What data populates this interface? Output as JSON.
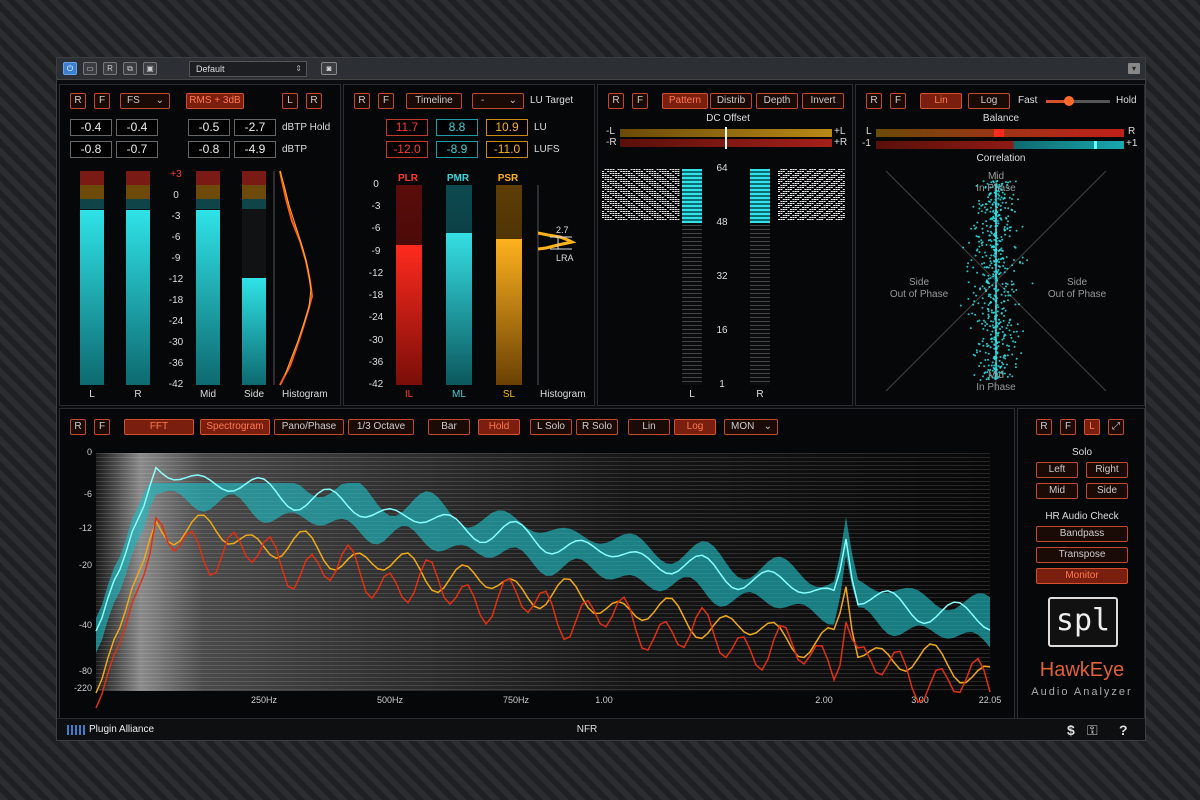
{
  "host": {
    "preset": "Default",
    "buttons": [
      "power-icon",
      "compare-icon",
      "rw-icon",
      "copy-icon",
      "paste-icon"
    ]
  },
  "panel1": {
    "buttons": {
      "r": "R",
      "f": "F",
      "fs": "FS",
      "rms": "RMS + 3dB",
      "l": "L",
      "r2": "R"
    },
    "dbtp_hold_label": "dBTP Hold",
    "dbtp_label": "dBTP",
    "values": {
      "l_hold": "-0.4",
      "r_hold": "-0.4",
      "mid_hold": "-0.5",
      "side_hold": "-2.7",
      "l_dbtp": "-0.8",
      "r_dbtp": "-0.7",
      "mid_dbtp": "-0.8",
      "side_dbtp": "-4.9"
    },
    "scale": [
      "+3",
      "0",
      "-3",
      "-6",
      "-9",
      "-12",
      "-18",
      "-24",
      "-30",
      "-36",
      "-42"
    ],
    "meter_labels": {
      "l": "L",
      "r": "R",
      "mid": "Mid",
      "side": "Side",
      "histogram": "Histogram"
    },
    "levels": {
      "l": 0.82,
      "r": 0.82,
      "mid": 0.82,
      "side": 0.5
    }
  },
  "panel2": {
    "buttons": {
      "r": "R",
      "f": "F",
      "timeline": "Timeline",
      "dash": "-"
    },
    "lu_target": "LU Target",
    "row_lu": [
      "11.7",
      "8.8",
      "10.9"
    ],
    "row_lufs": [
      "-12.0",
      "-8.9",
      "-11.0"
    ],
    "lu_label": "LU",
    "lufs_label": "LUFS",
    "top_labels": [
      "PLR",
      "PMR",
      "PSR"
    ],
    "bottom_labels": [
      "IL",
      "ML",
      "SL",
      "Histogram"
    ],
    "scale": [
      "0",
      "-3",
      "-6",
      "-9",
      "-12",
      "-18",
      "-24",
      "-30",
      "-36",
      "-42"
    ],
    "bar_levels": [
      0.7,
      0.76,
      0.73
    ],
    "lra_value": "2.7",
    "lra_label": "LRA"
  },
  "panel3": {
    "buttons": {
      "r": "R",
      "f": "F",
      "pattern": "Pattern",
      "distrib": "Distrib",
      "depth": "Depth",
      "invert": "Invert"
    },
    "dc_offset": "DC Offset",
    "dc_left": [
      "-L",
      "-R"
    ],
    "dc_right": [
      "+L",
      "+R"
    ],
    "scale": [
      "64",
      "48",
      "32",
      "16",
      "1"
    ],
    "bottom": [
      "L",
      "R"
    ]
  },
  "panel4": {
    "buttons": {
      "r": "R",
      "f": "F",
      "lin": "Lin",
      "log": "Log"
    },
    "fast": "Fast",
    "hold": "Hold",
    "balance": "Balance",
    "bal_l": "L",
    "bal_r": "R",
    "corr_minus": "-1",
    "corr_plus": "+1",
    "correlation": "Correlation",
    "mid_top": [
      "Mid",
      "In Phase"
    ],
    "mid_bottom": [
      "Mid",
      "In Phase"
    ],
    "side_left": [
      "Side",
      "Out of Phase"
    ],
    "side_right": [
      "Side",
      "Out of Phase"
    ]
  },
  "spectrum": {
    "buttons": {
      "r": "R",
      "f": "F",
      "fft": "FFT",
      "spectrogram": "Spectrogram",
      "panophase": "Pano/Phase",
      "octave": "1/3 Octave",
      "bar": "Bar",
      "hold": "Hold",
      "lsolo": "L Solo",
      "rsolo": "R Solo",
      "lin": "Lin",
      "log": "Log",
      "mon": "MON"
    },
    "y_ticks": [
      "0",
      "-6",
      "-12",
      "-20",
      "-40",
      "-80",
      "-220"
    ],
    "x_ticks": [
      "250Hz",
      "500Hz",
      "750Hz",
      "1.00",
      "2.00",
      "3.00",
      "22.05"
    ]
  },
  "side": {
    "buttons": {
      "r": "R",
      "f": "F",
      "l": "L"
    },
    "solo": "Solo",
    "left": "Left",
    "right": "Right",
    "mid": "Mid",
    "side": "Side",
    "hr": "HR Audio Check",
    "bandpass": "Bandpass",
    "transpose": "Transpose",
    "monitor": "Monitor",
    "logo": "spl",
    "product": "HawkEye",
    "subtitle": "Audio Analyzer"
  },
  "footer": {
    "brand": "Plugin Alliance",
    "nfr": "NFR",
    "dollar": "$",
    "help": "?"
  },
  "colors": {
    "accent": "#d5502c",
    "cyan": "#2fe3e8",
    "red": "#e02020",
    "yellow": "#f0a818"
  }
}
